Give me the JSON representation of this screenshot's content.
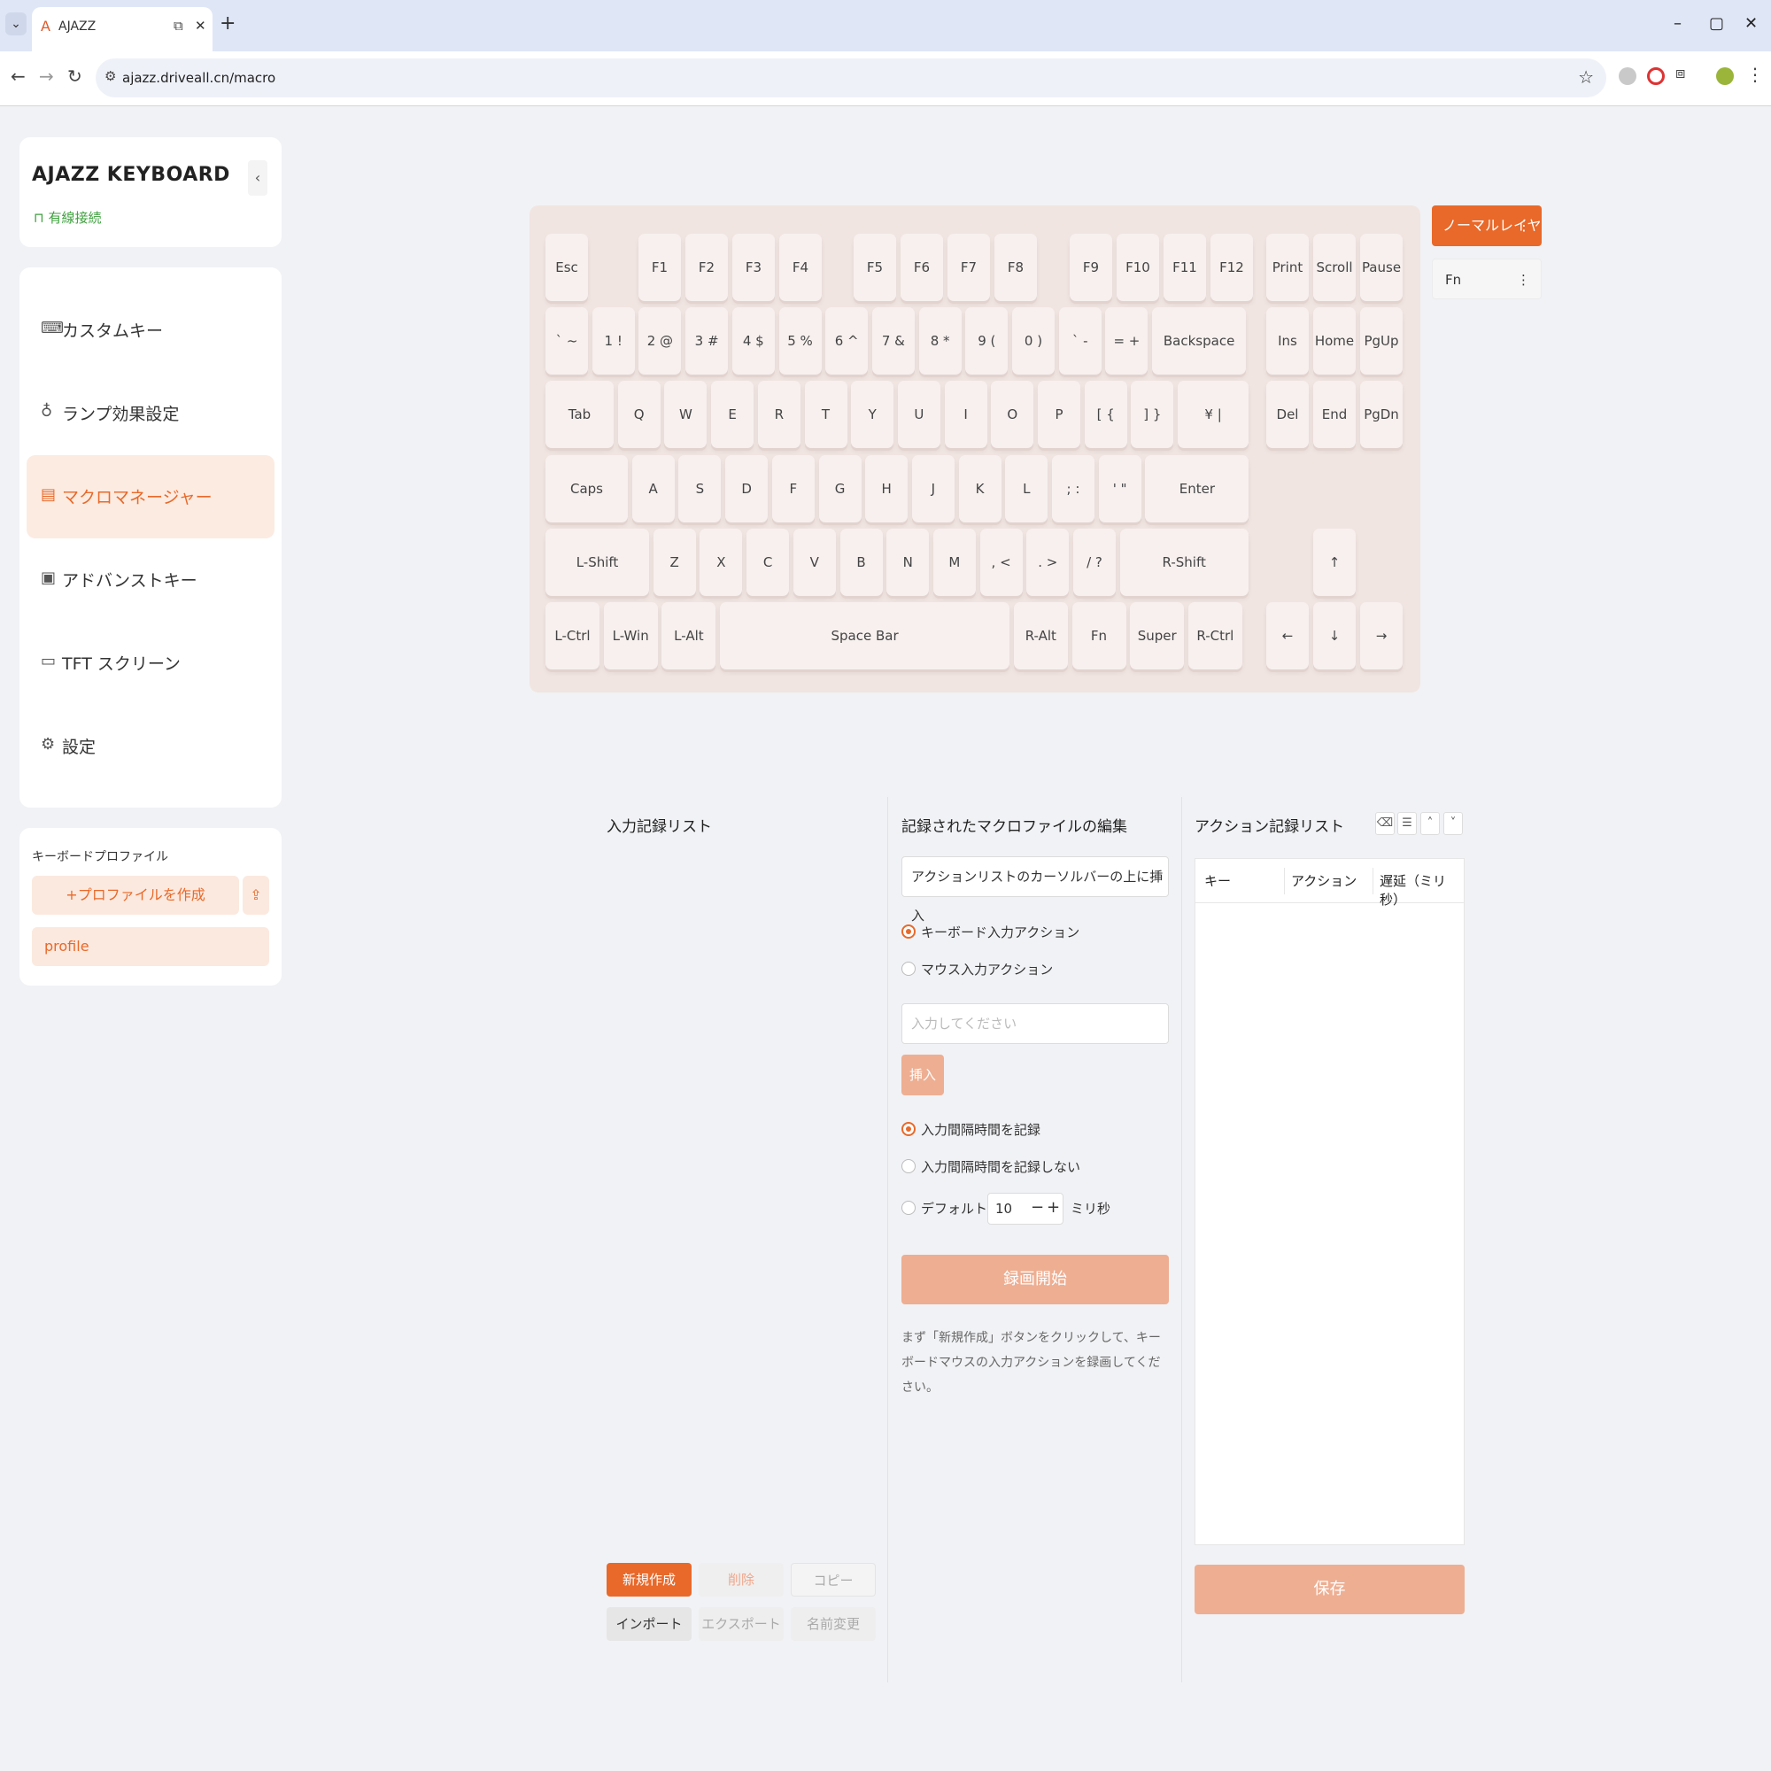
{
  "browser": {
    "tab_title": "AJAZZ",
    "tab_list_glyph": "⌄",
    "tab_favicon": "A",
    "tab_close": "✕",
    "tab_new": "+",
    "url": "ajazz.driveall.cn/macro",
    "window_minimize": "–",
    "window_restore": "▢",
    "window_close": "✕"
  },
  "sidebar": {
    "brand": "AJAZZ KEYBOARD",
    "collapse_glyph": "‹",
    "connection": "有線接続",
    "items": [
      {
        "label": "カスタムキー",
        "icon": "⌨"
      },
      {
        "label": "ランプ効果設定",
        "icon": "♁"
      },
      {
        "label": "マクロマネージャー",
        "icon": "▤"
      },
      {
        "label": "アドバンストキー",
        "icon": "▣"
      },
      {
        "label": "TFT スクリーン",
        "icon": "▭"
      },
      {
        "label": "設定",
        "icon": "⚙"
      }
    ],
    "profiles": {
      "title": "キーボードプロファイル",
      "create_label": "+プロファイルを作成",
      "import_icon": "⇪",
      "items": [
        "profile"
      ]
    }
  },
  "keyboard": {
    "rows": [
      [
        "Esc",
        "F1",
        "F2",
        "F3",
        "F4",
        "F5",
        "F6",
        "F7",
        "F8",
        "F9",
        "F10",
        "F11",
        "F12",
        "Print",
        "Scroll",
        "Pause"
      ],
      [
        "` ~",
        "1 !",
        "2 @",
        "3 #",
        "4 $",
        "5 %",
        "6 ^",
        "7 &",
        "8 *",
        "9 (",
        "0 )",
        "` -",
        "= +",
        "Backspace",
        "Ins",
        "Home",
        "PgUp"
      ],
      [
        "Tab",
        "Q",
        "W",
        "E",
        "R",
        "T",
        "Y",
        "U",
        "I",
        "O",
        "P",
        "[ {",
        "] }",
        "¥ |",
        "Del",
        "End",
        "PgDn"
      ],
      [
        "Caps",
        "A",
        "S",
        "D",
        "F",
        "G",
        "H",
        "J",
        "K",
        "L",
        "; :",
        "' \"",
        "Enter"
      ],
      [
        "L-Shift",
        "Z",
        "X",
        "C",
        "V",
        "B",
        "N",
        "M",
        ", <",
        ". >",
        "/ ?",
        "R-Shift",
        "↑"
      ],
      [
        "L-Ctrl",
        "L-Win",
        "L-Alt",
        "Space Bar",
        "R-Alt",
        "Fn",
        "Super",
        "R-Ctrl",
        "←",
        "↓",
        "→"
      ]
    ],
    "layers": [
      {
        "label": "ノーマルレイヤー",
        "active": true
      },
      {
        "label": "Fn",
        "active": false
      }
    ],
    "layer_menu_glyph": "⋮"
  },
  "input_list": {
    "title": "入力記録リスト",
    "buttons": {
      "new": "新規作成",
      "delete": "削除",
      "copy": "コピー",
      "import": "インポート",
      "export": "エクスポート",
      "rename": "名前変更"
    }
  },
  "editor": {
    "title": "記録されたマクロファイルの編集",
    "insert_position": "アクションリストのカーソルバーの上に挿入",
    "action_types": [
      "キーボード入力アクション",
      "マウス入力アクション"
    ],
    "selected_action_type": 0,
    "input_placeholder": "入力してください",
    "insert_label": "挿入",
    "interval_options": [
      "入力間隔時間を記録",
      "入力間隔時間を記録しない",
      "デフォルト間隔"
    ],
    "selected_interval": 0,
    "default_interval_value": "10",
    "interval_unit": "ミリ秒",
    "record_label": "録画開始",
    "hint": "まず「新規作成」ボタンをクリックして、キーボードマウスの入力アクションを録画してください。"
  },
  "action_list": {
    "title": "アクション記録リスト",
    "columns": [
      "キー",
      "アクション",
      "遅延（ミリ秒）"
    ],
    "rows": [],
    "save_label": "保存"
  },
  "colors": {
    "accent": "#e8692a",
    "accent_light": "#fbe9df",
    "accent_disabled": "#eeae92",
    "keyboard_bg": "#f1e5e1",
    "key_bg": "#f7f0ee",
    "connected": "#3ea03e"
  }
}
